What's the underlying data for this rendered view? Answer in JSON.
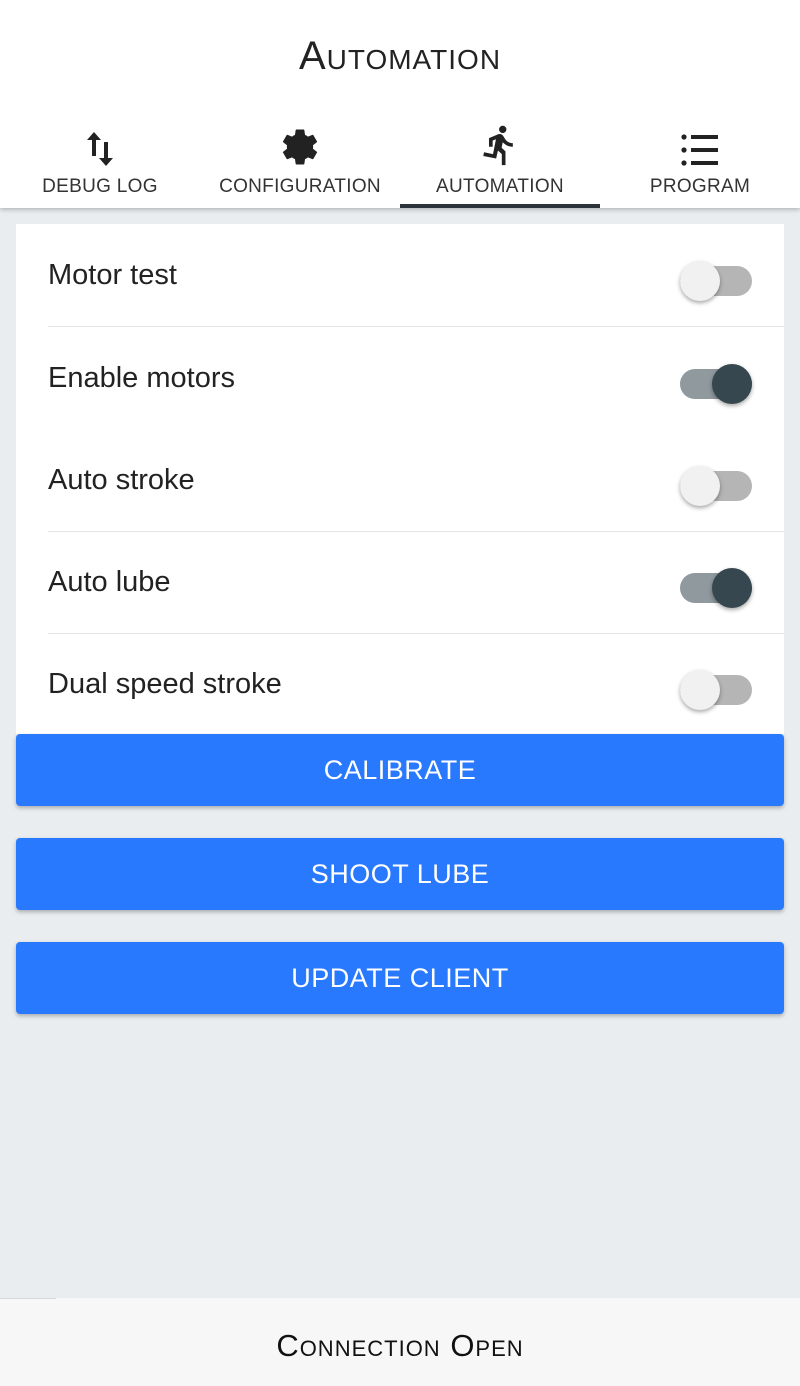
{
  "app": {
    "title": "Automation"
  },
  "tabs": [
    {
      "label": "DEBUG LOG",
      "icon": "swap-vertical-icon",
      "active": false
    },
    {
      "label": "CONFIGURATION",
      "icon": "gear-icon",
      "active": false
    },
    {
      "label": "AUTOMATION",
      "icon": "running-person-icon",
      "active": true
    },
    {
      "label": "PROGRAM",
      "icon": "list-icon",
      "active": false
    }
  ],
  "settings": [
    {
      "label": "Motor test",
      "checked": false
    },
    {
      "label": "Enable motors",
      "checked": true
    },
    {
      "label": "Auto stroke",
      "checked": false
    },
    {
      "label": "Auto lube",
      "checked": true
    },
    {
      "label": "Dual speed stroke",
      "checked": false
    }
  ],
  "buttons": {
    "calibrate": "CALIBRATE",
    "shoot_lube": "SHOOT LUBE",
    "update_client": "UPDATE CLIENT"
  },
  "footer": {
    "status": "Connection Open"
  },
  "colors": {
    "accent": "#2979ff",
    "toggle_on_thumb": "#37474f",
    "toggle_on_track": "#8f999e",
    "toggle_off_thumb": "#f1f1f1",
    "toggle_off_track": "#b5b5b5",
    "background": "#e9edf0"
  }
}
